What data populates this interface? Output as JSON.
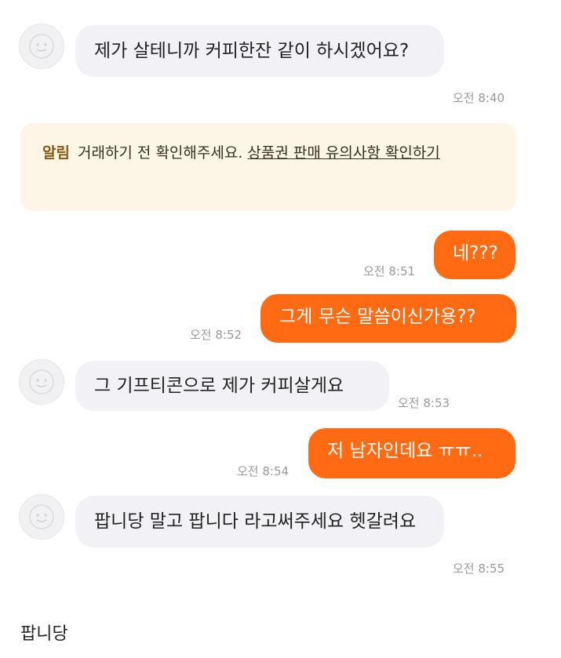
{
  "messages": [
    {
      "text": "제가 살테니까 커피한잔 같이 하시겠어요?",
      "time": "오전 8:40"
    },
    {
      "text": "네???",
      "time": "오전 8:51"
    },
    {
      "text": "그게 무슨 말씀이신가용??",
      "time": "오전 8:52"
    },
    {
      "text": "그 기프티콘으로 제가 커피살게요",
      "time": "오전 8:53"
    },
    {
      "text": "저 남자인데요 ㅠㅠ..",
      "time": "오전 8:54"
    },
    {
      "text": "팝니당 말고 팝니다 라고써주세요 헷갈려요",
      "time": "오전 8:55"
    }
  ],
  "notice": {
    "tag": "알림",
    "text": "거래하기 전 확인해주세요.",
    "link": "상품권 판매 유의사항 확인하기"
  },
  "bottom_text": "팝니당",
  "colors": {
    "outgoing": "#ff6a13",
    "incoming": "#f2f2f6",
    "notice": "#fdf5e6"
  }
}
